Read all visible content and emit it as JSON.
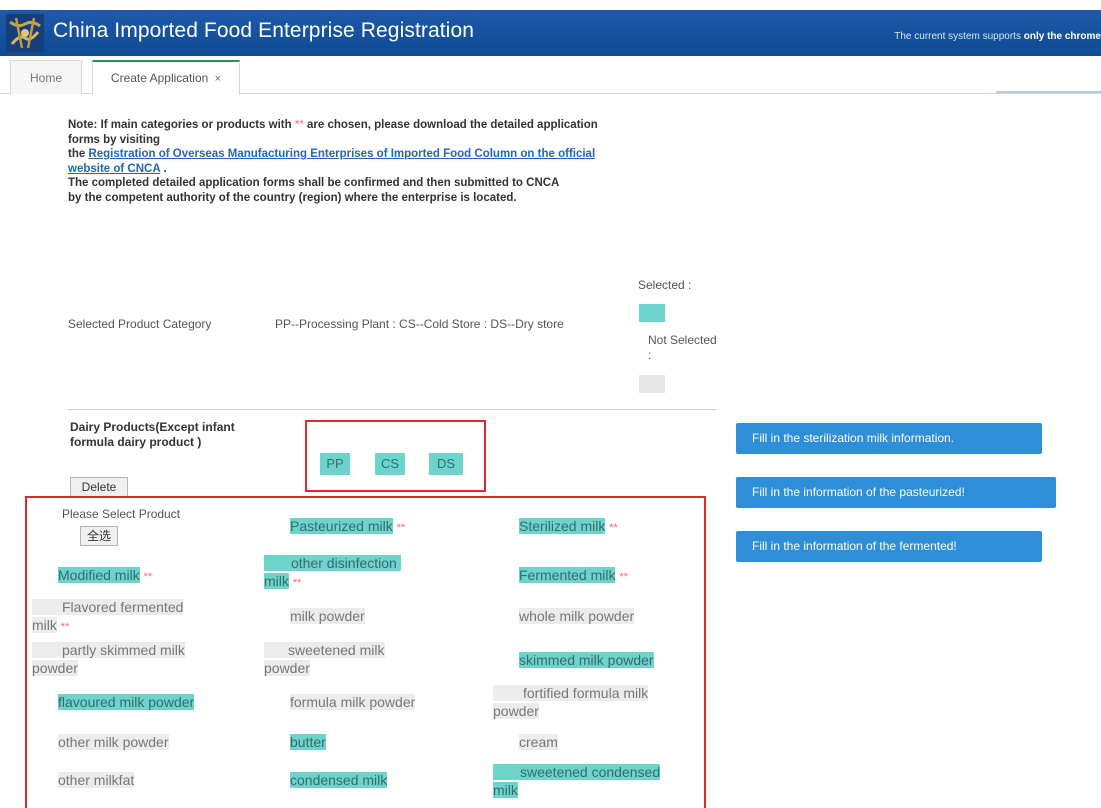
{
  "header": {
    "title": "China Imported Food Enterprise Registration",
    "note_prefix": "The current system supports",
    "note_bold": "only the chrome"
  },
  "tabs": [
    {
      "label": "Home"
    },
    {
      "label": "Create Application",
      "close": "×"
    }
  ],
  "note": {
    "line1": "Note: If main categories or products with",
    "stars": "**",
    "line1b": "are chosen, please download the detailed application forms by visiting",
    "line2": "the",
    "link": "Registration of Overseas Manufacturing Enterprises of Imported Food Column on the official website of CNCA",
    "line2b": ".",
    "line3": "The completed detailed application forms shall be confirmed and then submitted to CNCA",
    "line4": "by the competent authority of the country (region) where the enterprise is located."
  },
  "category": {
    "label": "Selected Product Category",
    "description": "PP--Processing Plant : CS--Cold Store : DS--Dry store",
    "legend_selected": "Selected :",
    "legend_not_selected": "Not Selected :"
  },
  "dairy": {
    "label": "Dairy Products(Except infant formula dairy product )",
    "delete": "Delete",
    "tags": [
      "PP",
      "CS",
      "DS"
    ]
  },
  "actions": [
    "Fill in the sterilization milk information.",
    "Fill in the information of the pasteurized!",
    "Fill in the information of the fermented!"
  ],
  "products": {
    "prompt": "Please Select Product",
    "select_all": "全选",
    "items": [
      {
        "label": "Pasteurized milk",
        "star": "**",
        "selected": true
      },
      {
        "label": "Sterilized milk",
        "star": "**",
        "selected": true
      },
      {
        "label": "Modified milk",
        "star": "**",
        "selected": true
      },
      {
        "label": "other disinfection",
        "label2": "milk",
        "star": "**",
        "selected": true
      },
      {
        "label": "Fermented milk",
        "star": "**",
        "selected": true
      },
      {
        "label": "Flavored fermented",
        "label2": "milk",
        "star": "**",
        "selected": false
      },
      {
        "label": "milk powder",
        "selected": false
      },
      {
        "label": "whole milk powder",
        "selected": false
      },
      {
        "label": "partly skimmed milk",
        "label2": "powder",
        "selected": false
      },
      {
        "label": "sweetened milk",
        "label2": "powder",
        "selected": false
      },
      {
        "label": "skimmed milk powder",
        "selected": true
      },
      {
        "label": "flavoured milk powder",
        "selected": true
      },
      {
        "label": "formula milk powder",
        "selected": false
      },
      {
        "label": "fortified formula milk",
        "label2": "powder",
        "selected": false
      },
      {
        "label": "other milk powder",
        "selected": false
      },
      {
        "label": "butter",
        "selected": true
      },
      {
        "label": "cream",
        "selected": false
      },
      {
        "label": "other milkfat",
        "selected": false
      },
      {
        "label": "condensed milk",
        "selected": true
      },
      {
        "label": "sweetened condensed",
        "label2": "milk",
        "selected": true
      }
    ]
  },
  "colors": {
    "header_bg": "#1254a0",
    "selected": "#6dd4cc",
    "not_selected": "#e7e7e7",
    "action_button": "#2f8ed8",
    "highlight_box": "#e3282d",
    "star": "#ff6a6a"
  }
}
